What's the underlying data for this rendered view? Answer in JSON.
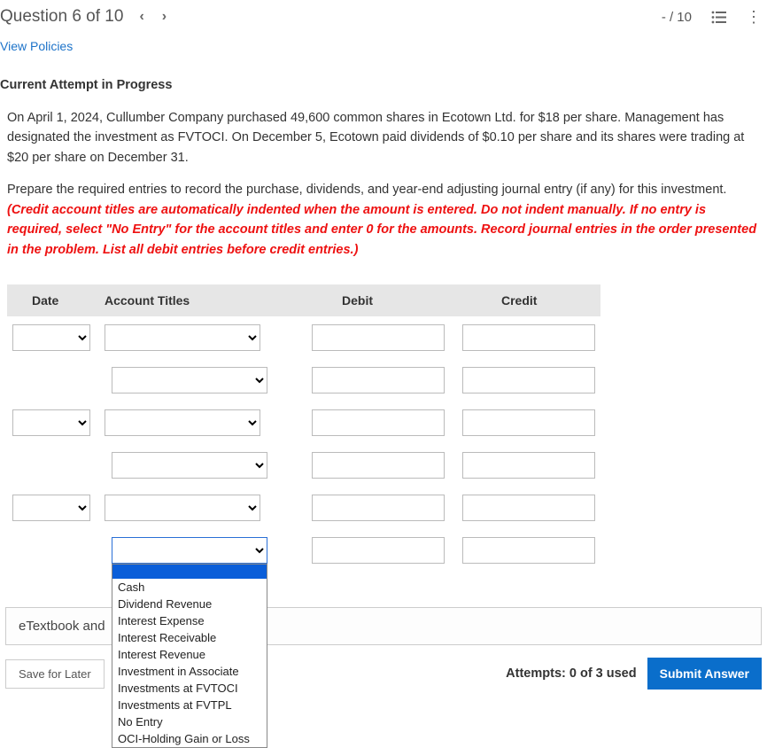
{
  "header": {
    "question_label": "Question 6 of 10",
    "score": "- / 10"
  },
  "links": {
    "view_policies": "View Policies"
  },
  "section": {
    "title": "Current Attempt in Progress"
  },
  "problem": {
    "para1": "On April 1, 2024, Cullumber Company purchased 49,600 common shares in Ecotown Ltd. for $18 per share. Management has designated the investment as FVTOCI. On December 5, Ecotown paid dividends of $0.10 per share and its shares were trading at $20 per share on December 31.",
    "para2_lead": "Prepare the required entries to record the purchase, dividends, and year-end adjusting journal entry (if any) for this investment. ",
    "para2_red": "(Credit account titles are automatically indented when the amount is entered. Do not indent manually. If no entry is required, select \"No Entry\" for the account titles and enter 0 for the amounts. Record journal entries in the order presented in the problem. List all debit entries before credit entries.)"
  },
  "table": {
    "headers": {
      "date": "Date",
      "acct": "Account Titles",
      "debit": "Debit",
      "credit": "Credit"
    }
  },
  "dropdown_options": [
    "Cash",
    "Dividend Revenue",
    "Interest Expense",
    "Interest Receivable",
    "Interest Revenue",
    "Investment in Associate",
    "Investments at FVTOCI",
    "Investments at FVTPL",
    "No Entry",
    "OCI-Holding Gain or Loss"
  ],
  "footer": {
    "etextbook": "eTextbook and",
    "save_later": "Save for Later",
    "attempts": "Attempts: 0 of 3 used",
    "submit": "Submit Answer"
  }
}
